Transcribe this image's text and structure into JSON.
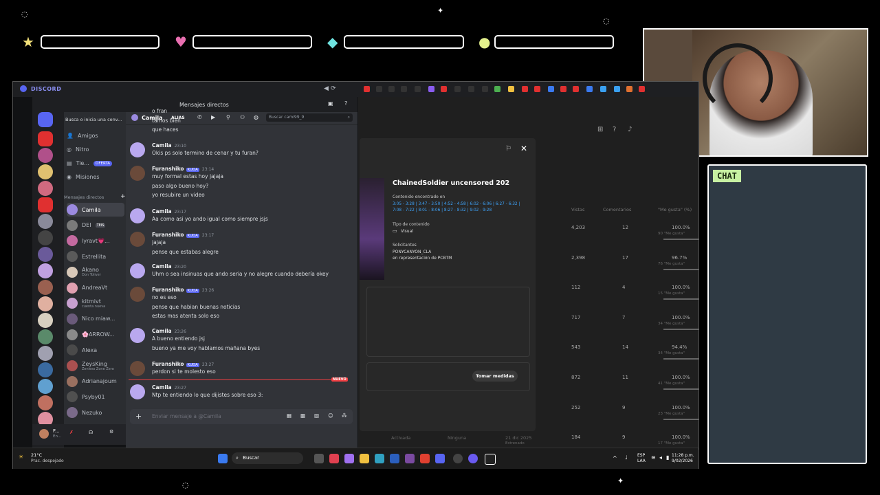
{
  "overlay": {
    "chat_label": "CHAT"
  },
  "browser": {
    "app_logo": "DISCORD",
    "dm_header": "Mensajes directos"
  },
  "discord": {
    "search_placeholder": "Busca o inicia una conv...",
    "friends_label": "Amigos",
    "nitro_label": "Nitro",
    "store_label": "Tie...",
    "store_badge": "OFERTA",
    "missions_label": "Misiones",
    "dm_section_label": "Mensajes directos",
    "dms": [
      {
        "name": "Camila",
        "active": true,
        "color": "#9b8ae0"
      },
      {
        "name": "DEI",
        "badge": "TEIS",
        "color": "#7a7a7a"
      },
      {
        "name": "lyravt💗...",
        "color": "#c46aa0"
      },
      {
        "name": "Estrellita",
        "color": "#5a5a5a"
      },
      {
        "name": "Akano",
        "sub": "Don Toliver",
        "color": "#d8c8b8"
      },
      {
        "name": "AndreaVt",
        "color": "#e0a0b0"
      },
      {
        "name": "kitmivt",
        "sub": "cuenta nueva",
        "color": "#c8a0d0"
      },
      {
        "name": "Nico miaw...",
        "color": "#6a5a7a"
      },
      {
        "name": "🌸ARROW...",
        "color": "#8a8a8a"
      },
      {
        "name": "Alexa",
        "color": "#4a4a4a"
      },
      {
        "name": "ZeysKing",
        "sub": "Zenless Zone Zero",
        "color": "#aa5050"
      },
      {
        "name": "Adrianajoum",
        "color": "#9a7060"
      },
      {
        "name": "Psyby01",
        "color": "#505050"
      },
      {
        "name": "Nezuko",
        "color": "#7a6a8a"
      }
    ],
    "user_panel_name": "F...",
    "user_panel_status": "En..."
  },
  "chat": {
    "channel_name": "Camila",
    "alias_label": "ALIAS",
    "search_placeholder": "Buscar cami99_9",
    "input_placeholder": "Enviar mensaje a @Camila",
    "new_badge": "NUEVO",
    "messages": [
      {
        "lines": [
          "o fran",
          "tamos bien",
          "que haces"
        ]
      },
      {
        "name": "Camila",
        "time": "23:10",
        "lines": [
          "Okis ps solo termino de cenar y tu furan?"
        ]
      },
      {
        "name": "Furanshiko",
        "badge": "KUDA",
        "time": "23:14",
        "lines": [
          "muy formal estas hoy jajaja",
          "paso algo bueno hoy?",
          "yo resubire un video"
        ]
      },
      {
        "name": "Camila",
        "time": "23:17",
        "lines": [
          "Aa como asi yo ando igual como siempre jsjs"
        ]
      },
      {
        "name": "Furanshiko",
        "badge": "KUDA",
        "time": "23:17",
        "lines": [
          "jajaja",
          "pense que estabas alegre"
        ]
      },
      {
        "name": "Camila",
        "time": "23:20",
        "lines": [
          "Uhm o sea insinuas que ando seria y no alegre cuando debería okey"
        ]
      },
      {
        "name": "Furanshiko",
        "badge": "KUDA",
        "time": "23:26",
        "lines": [
          "no es eso",
          "pense que habian buenas noticias",
          "estas mas atenta solo eso"
        ]
      },
      {
        "name": "Camila",
        "time": "23:26",
        "lines": [
          "A bueno entiendo jsj",
          "bueno ya me voy hablamos mañana byes"
        ]
      },
      {
        "name": "Furanshiko",
        "badge": "KUDA",
        "time": "23:27",
        "lines": [
          "perdon si te molesto eso"
        ]
      },
      {
        "name": "Camila",
        "time": "23:27",
        "lines": [
          "Ntp te entiendo lo que dijistes sobre eso 3:"
        ]
      }
    ]
  },
  "youtube": {
    "col_views": "Vistas",
    "col_comments": "Comentarios",
    "col_likes": "\"Me gusta\" (%)",
    "rows": [
      {
        "views": "4,203",
        "comments": "12",
        "likes": "100.0%",
        "likes_sub": "90 \"Me gusta\""
      },
      {
        "views": "2,398",
        "comments": "17",
        "likes": "96.7%",
        "likes_sub": "76 \"Me gusta\""
      },
      {
        "views": "112",
        "comments": "4",
        "likes": "100.0%",
        "likes_sub": "15 \"Me gusta\""
      },
      {
        "views": "717",
        "comments": "7",
        "likes": "100.0%",
        "likes_sub": "34 \"Me gusta\""
      },
      {
        "views": "543",
        "comments": "14",
        "likes": "94.4%",
        "likes_sub": "34 \"Me gusta\""
      },
      {
        "views": "872",
        "comments": "11",
        "likes": "100.0%",
        "likes_sub": "41 \"Me gusta\""
      },
      {
        "views": "252",
        "comments": "9",
        "likes": "100.0%",
        "likes_sub": "23 \"Me gusta\""
      },
      {
        "views": "184",
        "comments": "9",
        "likes": "100.0%",
        "likes_sub": "17 \"Me gusta\""
      }
    ],
    "last_row_status": "Activada",
    "last_row_restriction": "Ninguna",
    "last_row_date": "21 dic 2025",
    "last_row_date_sub": "Estrenado",
    "modal": {
      "title": "ChainedSoldier uncensored 202",
      "found_label": "Contenido encontrado en",
      "found_value": "3:05 - 3:28 | 3:47 - 3:50 | 4:52 - 4:58 | 6:02 - 6:06 | 6:27 - 6:32 | 7:08 - 7:22 | 8:01 - 8:06 | 8:27 - 8:32 | 9:02 - 9:28",
      "type_label": "Tipo de contenido",
      "type_value": "Visual",
      "claimants_label": "Solicitantes",
      "claimant": "PONYCANYON_CLA",
      "claimant_sub": "en representación de PCBTM",
      "action_button": "Tomar medidas"
    }
  },
  "taskbar": {
    "weather_temp": "21°C",
    "weather_desc": "Prac. despejado",
    "search_label": "Buscar",
    "lang": "ESP",
    "lang_sub": "LAA",
    "time": "11:28 p.m.",
    "date": "9/02/2026"
  },
  "colors": {
    "discord_bg": "#313338",
    "discord_accent": "#5865f2",
    "link_blue": "#3ea6ff",
    "new_badge": "#f23f43",
    "chat_tag": "#c7f0a2"
  }
}
